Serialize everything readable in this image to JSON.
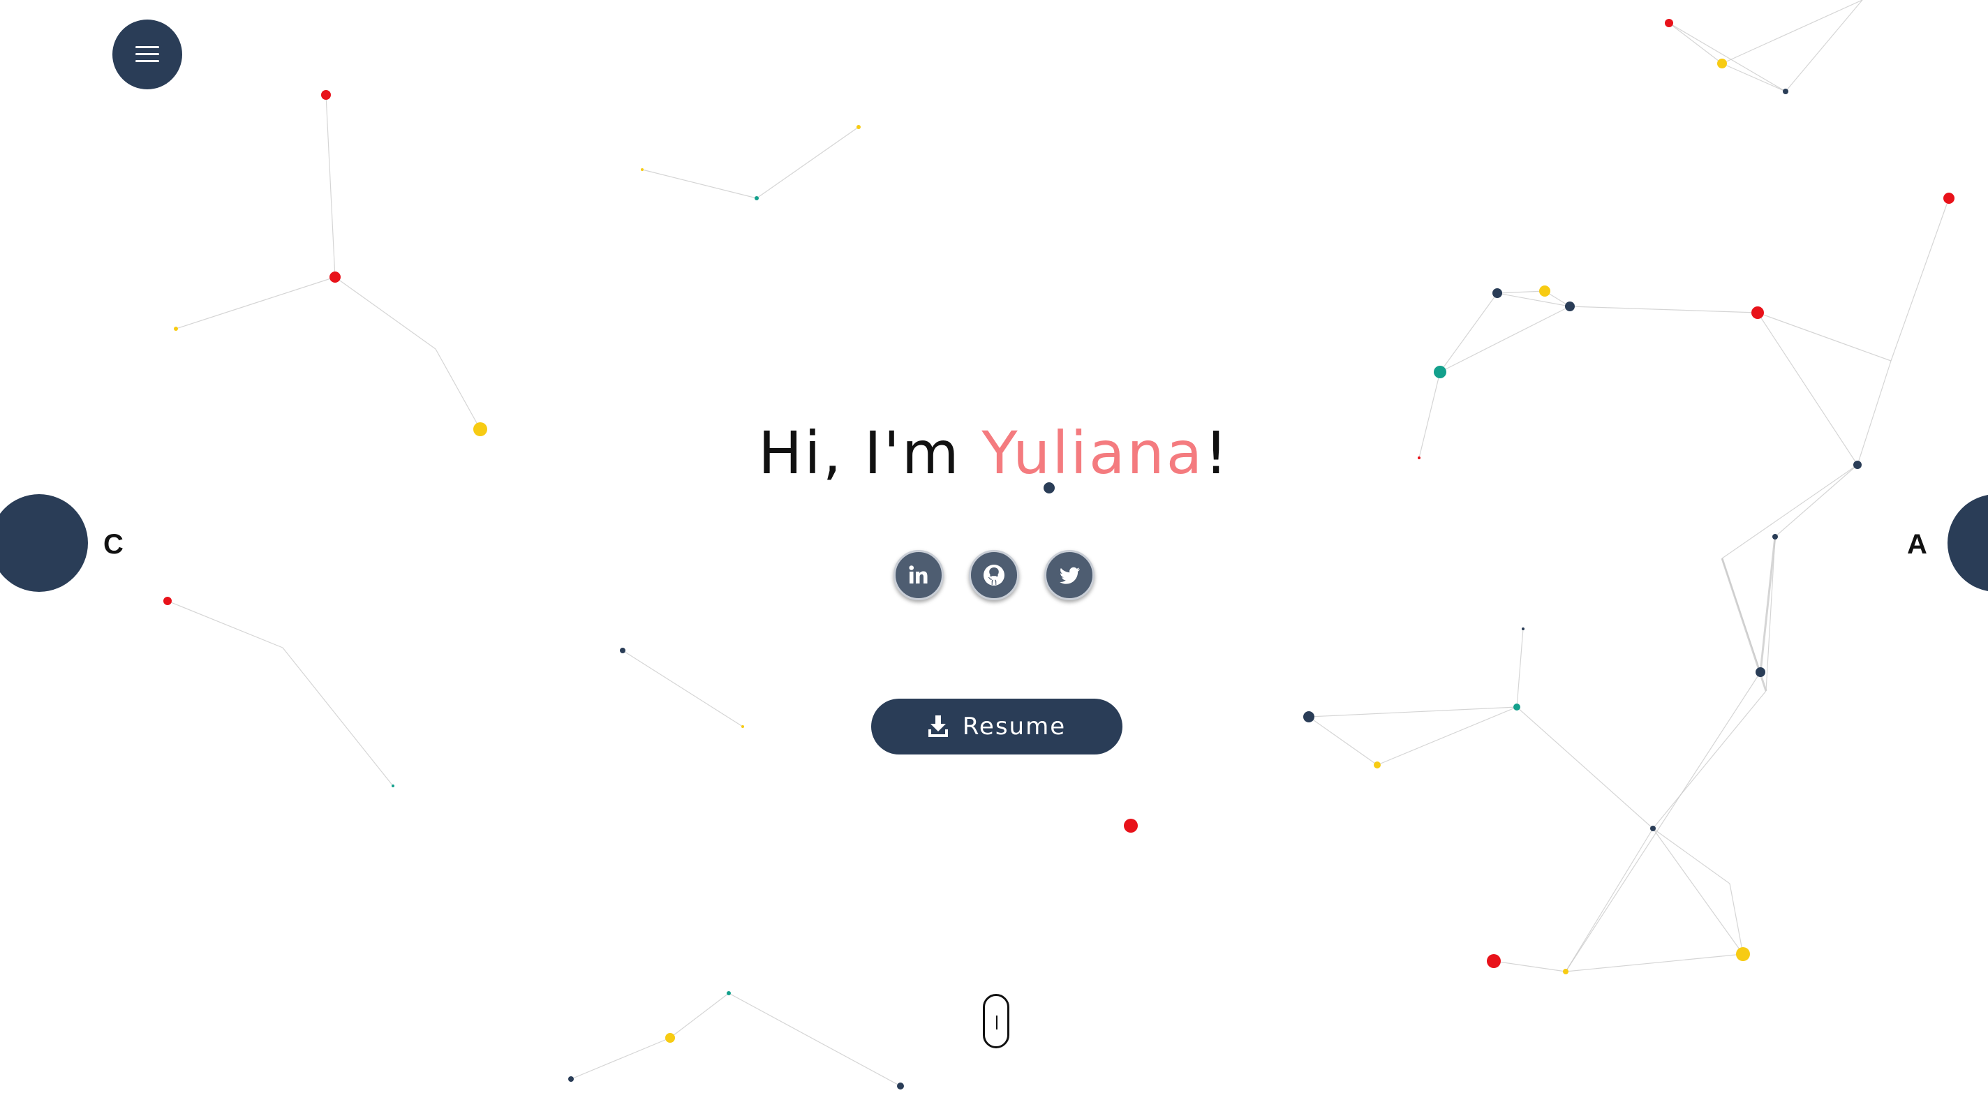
{
  "nav": {
    "menu_icon": "hamburger-icon",
    "left_tab_letter": "C",
    "right_tab_letter": "A"
  },
  "hero": {
    "greeting": "Hi, I'm ",
    "name": "Yuliana",
    "punctuation": "!",
    "name_color": "#f47b7f"
  },
  "social_links": [
    {
      "icon": "linkedin-icon"
    },
    {
      "icon": "github-icon"
    },
    {
      "icon": "twitter-icon"
    }
  ],
  "resume_button": {
    "label": "Resume",
    "icon": "download-icon"
  },
  "scroll_indicator": {
    "icon": "mouse-scroll-icon"
  },
  "colors": {
    "primary": "#2a3d57",
    "accent": "#f47b7f",
    "particle_red": "#e8121a",
    "particle_yellow": "#f7cb13",
    "particle_teal": "#13a08c",
    "particle_navy": "#2a3d57"
  }
}
